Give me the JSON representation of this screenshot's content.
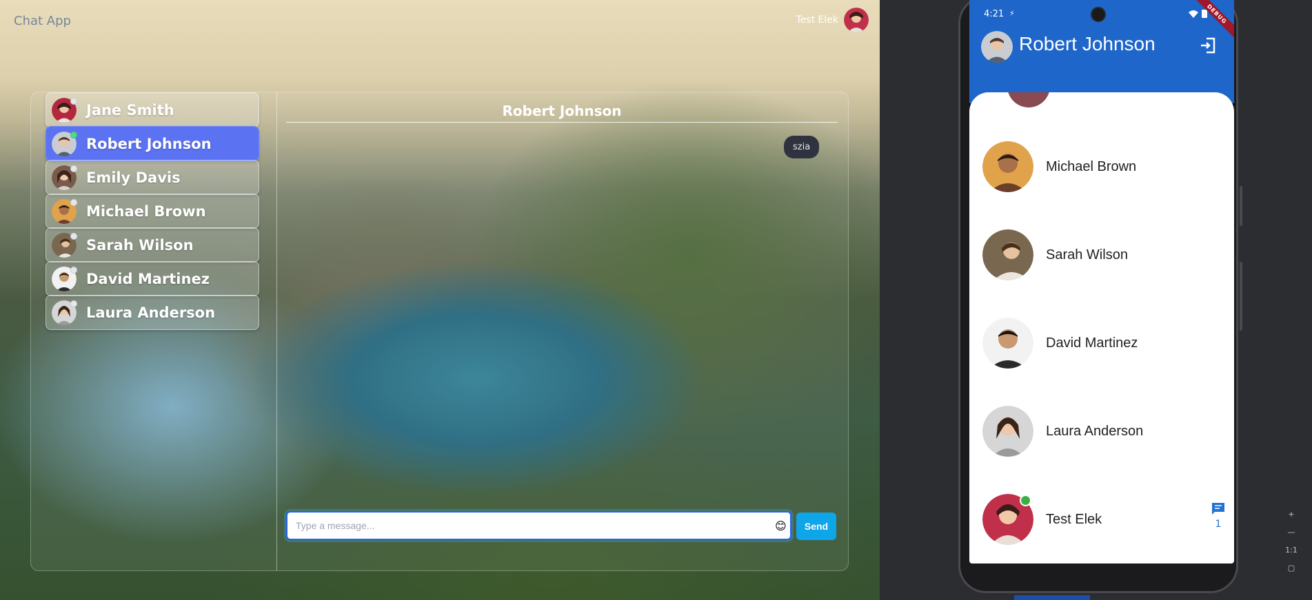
{
  "web": {
    "app_title": "Chat App",
    "current_user": "Test Elek",
    "contacts": [
      {
        "name": "Jane Smith",
        "status": "offline",
        "active": false
      },
      {
        "name": "Robert Johnson",
        "status": "online",
        "active": true
      },
      {
        "name": "Emily Davis",
        "status": "offline",
        "active": false
      },
      {
        "name": "Michael Brown",
        "status": "offline",
        "active": false
      },
      {
        "name": "Sarah Wilson",
        "status": "offline",
        "active": false
      },
      {
        "name": "David Martinez",
        "status": "offline",
        "active": false
      },
      {
        "name": "Laura Anderson",
        "status": "offline",
        "active": false
      }
    ],
    "chat": {
      "header": "Robert Johnson",
      "messages": [
        {
          "text": "szia",
          "from": "Robert Johnson"
        }
      ],
      "input_placeholder": "Type a message...",
      "input_value": "",
      "emoji": "😊",
      "send_label": "Send"
    },
    "colors": {
      "active_contact": "#5b73f2",
      "send_button": "#0ea5e9",
      "online": "#4ade80"
    }
  },
  "mobile": {
    "status": {
      "time": "4:21",
      "debug_banner": "DEBUG"
    },
    "appbar_title": "Robert Johnson",
    "contacts": [
      {
        "name": "Michael Brown",
        "online": false
      },
      {
        "name": "Sarah Wilson",
        "online": false
      },
      {
        "name": "David Martinez",
        "online": false
      },
      {
        "name": "Laura Anderson",
        "online": false
      },
      {
        "name": "Test Elek",
        "online": true,
        "unread": "1"
      }
    ],
    "colors": {
      "appbar": "#1e66c9",
      "online": "#3cb043",
      "unread_icon": "#2174d3"
    }
  },
  "emulator": {
    "zoom_controls": [
      "+",
      "—",
      "1:1",
      "▢"
    ]
  }
}
